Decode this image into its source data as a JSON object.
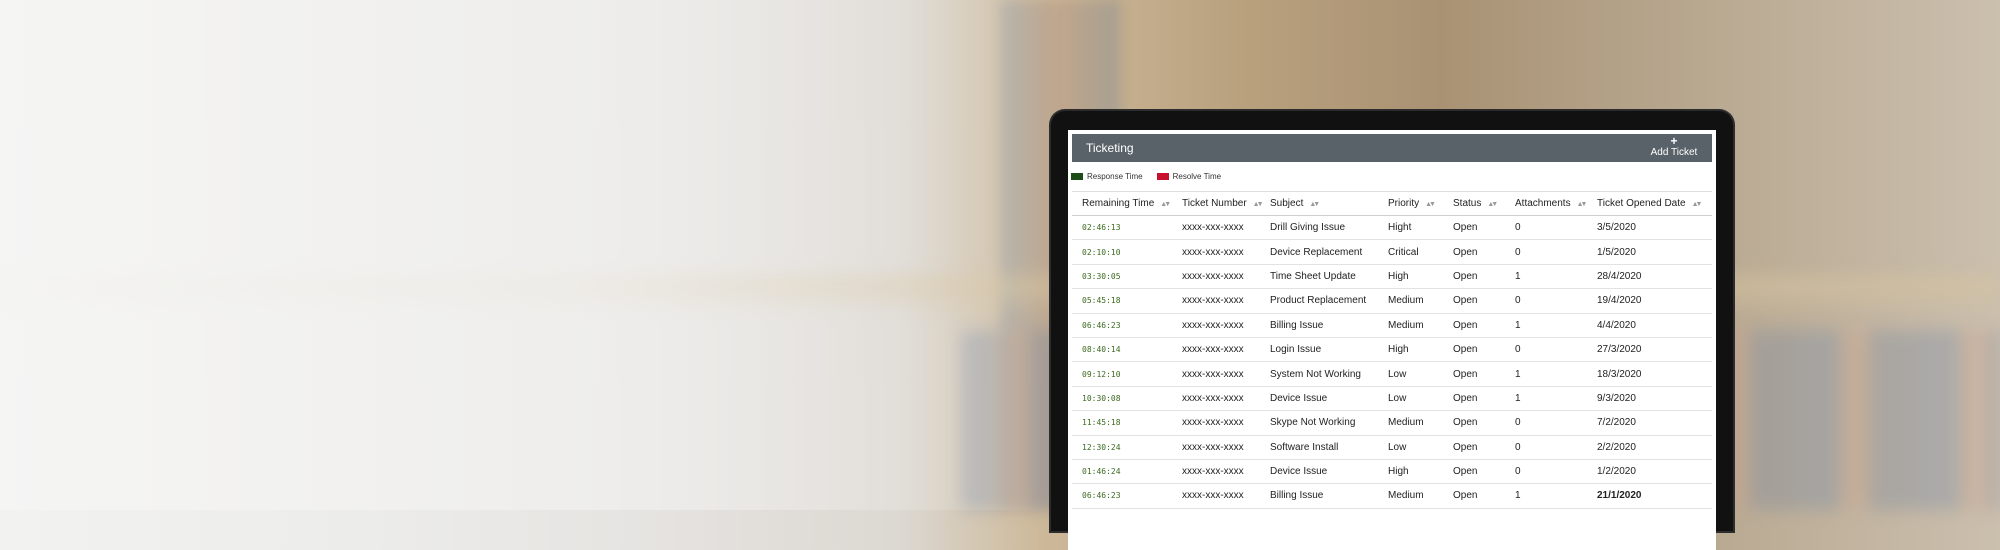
{
  "app": {
    "title": "Ticketing",
    "add_ticket_icon": "+",
    "add_ticket_label": "Add Ticket"
  },
  "legend": [
    {
      "label": "Response Time",
      "color": "#1f4d1a"
    },
    {
      "label": "Resolve Time",
      "color": "#c8102e"
    }
  ],
  "table": {
    "columns": [
      "Remaining Time",
      "Ticket Number",
      "Subject",
      "Priority",
      "Status",
      "Attachments",
      "Ticket Opened Date"
    ],
    "sort_icon": "sort-arrows-icon",
    "rows": [
      {
        "time": "02:46:13",
        "number": "xxxx-xxx-xxxx",
        "subject": "Drill Giving Issue",
        "priority": "Hight",
        "status": "Open",
        "attachments": "0",
        "date": "3/5/2020"
      },
      {
        "time": "02:10:10",
        "number": "xxxx-xxx-xxxx",
        "subject": "Device Replacement",
        "priority": "Critical",
        "status": "Open",
        "attachments": "0",
        "date": "1/5/2020"
      },
      {
        "time": "03:30:05",
        "number": "xxxx-xxx-xxxx",
        "subject": "Time Sheet Update",
        "priority": "High",
        "status": "Open",
        "attachments": "1",
        "date": "28/4/2020"
      },
      {
        "time": "05:45:18",
        "number": "xxxx-xxx-xxxx",
        "subject": "Product Replacement",
        "priority": "Medium",
        "status": "Open",
        "attachments": "0",
        "date": "19/4/2020"
      },
      {
        "time": "06:46:23",
        "number": "xxxx-xxx-xxxx",
        "subject": "Billing Issue",
        "priority": "Medium",
        "status": "Open",
        "attachments": "1",
        "date": "4/4/2020"
      },
      {
        "time": "08:40:14",
        "number": "xxxx-xxx-xxxx",
        "subject": "Login Issue",
        "priority": "High",
        "status": "Open",
        "attachments": "0",
        "date": "27/3/2020"
      },
      {
        "time": "09:12:10",
        "number": "xxxx-xxx-xxxx",
        "subject": "System Not Working",
        "priority": "Low",
        "status": "Open",
        "attachments": "1",
        "date": "18/3/2020"
      },
      {
        "time": "10:30:08",
        "number": "xxxx-xxx-xxxx",
        "subject": "Device Issue",
        "priority": "Low",
        "status": "Open",
        "attachments": "1",
        "date": "9/3/2020"
      },
      {
        "time": "11:45:18",
        "number": "xxxx-xxx-xxxx",
        "subject": "Skype Not Working",
        "priority": "Medium",
        "status": "Open",
        "attachments": "0",
        "date": "7/2/2020"
      },
      {
        "time": "12:30:24",
        "number": "xxxx-xxx-xxxx",
        "subject": "Software Install",
        "priority": "Low",
        "status": "Open",
        "attachments": "0",
        "date": "2/2/2020"
      },
      {
        "time": "01:46:24",
        "number": "xxxx-xxx-xxxx",
        "subject": "Device Issue",
        "priority": "High",
        "status": "Open",
        "attachments": "0",
        "date": "1/2/2020"
      },
      {
        "time": "06:46:23",
        "number": "xxxx-xxx-xxxx",
        "subject": "Billing Issue",
        "priority": "Medium",
        "status": "Open",
        "attachments": "1",
        "date": "21/1/2020"
      }
    ]
  }
}
